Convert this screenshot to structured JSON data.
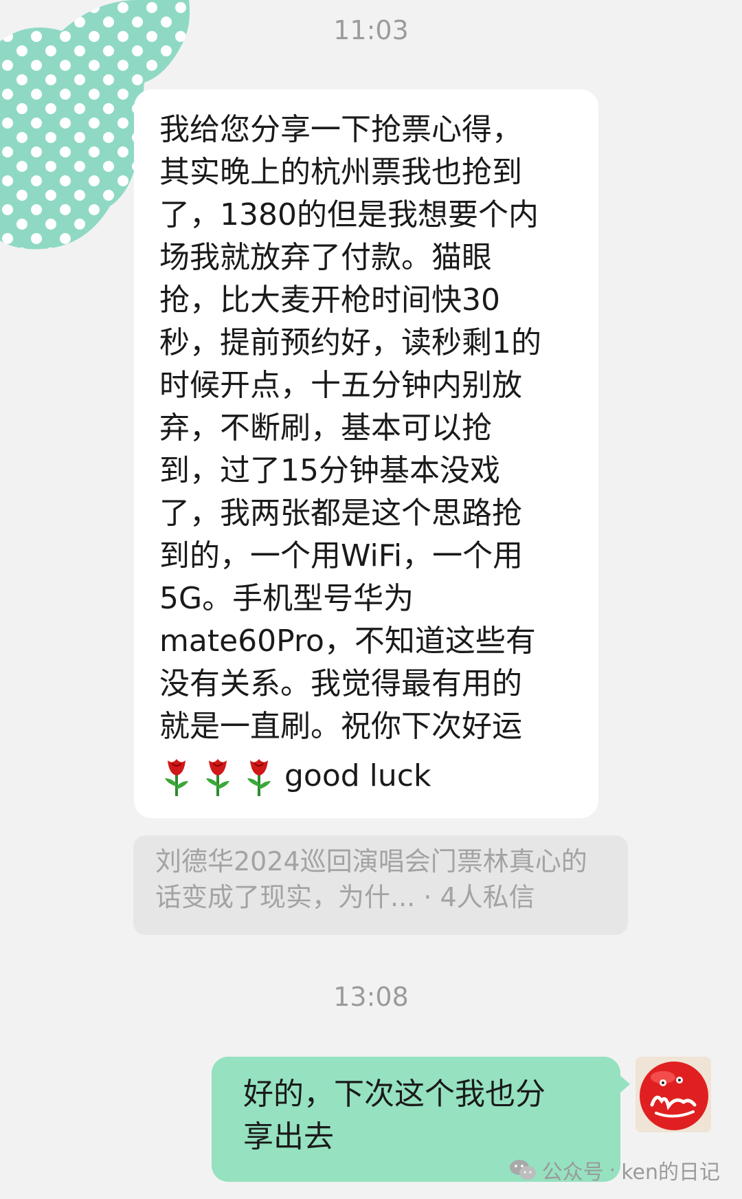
{
  "timestamps": {
    "first": "11:03",
    "second": "13:08"
  },
  "incoming_message": {
    "lines": [
      "我给您分享一下抢票心得，",
      "其实晚上的杭州票我也抢到",
      "了，1380的但是我想要个内",
      "场我就放弃了付款。猫眼",
      "抢，比大麦开枪时间快30",
      "秒，提前预约好，读秒剩1的",
      "时候开点，十五分钟内别放",
      "弃，不断刷，基本可以抢",
      "到，过了15分钟基本没戏",
      "了，我两张都是这个思路抢",
      "到的，一个用WiFi，一个用",
      "5G。手机型号华为",
      "mate60Pro，不知道这些有",
      "没有关系。我觉得最有用的",
      "就是一直刷。祝你下次好运"
    ],
    "emoji_icon": "rose-icon",
    "emoji_count": 3,
    "tail_text": "good luck"
  },
  "reference_card": {
    "line1": "刘德华2024巡回演唱会门票林真心的",
    "line2": "话变成了现实，为什... · 4人私信"
  },
  "outgoing_message": {
    "lines": [
      "好的，下次这个我也分",
      "享出去"
    ]
  },
  "watermark": {
    "icon": "wechat-icon",
    "label": "公众号",
    "separator": "·",
    "account": "ken的日记"
  },
  "colors": {
    "background": "#f2f2f2",
    "incoming_bubble": "#ffffff",
    "outgoing_bubble": "#95e1c0",
    "reference_card": "#e6e6e6",
    "dot_avatar": "#8fd9c4",
    "avatar_red": "#e02020"
  }
}
